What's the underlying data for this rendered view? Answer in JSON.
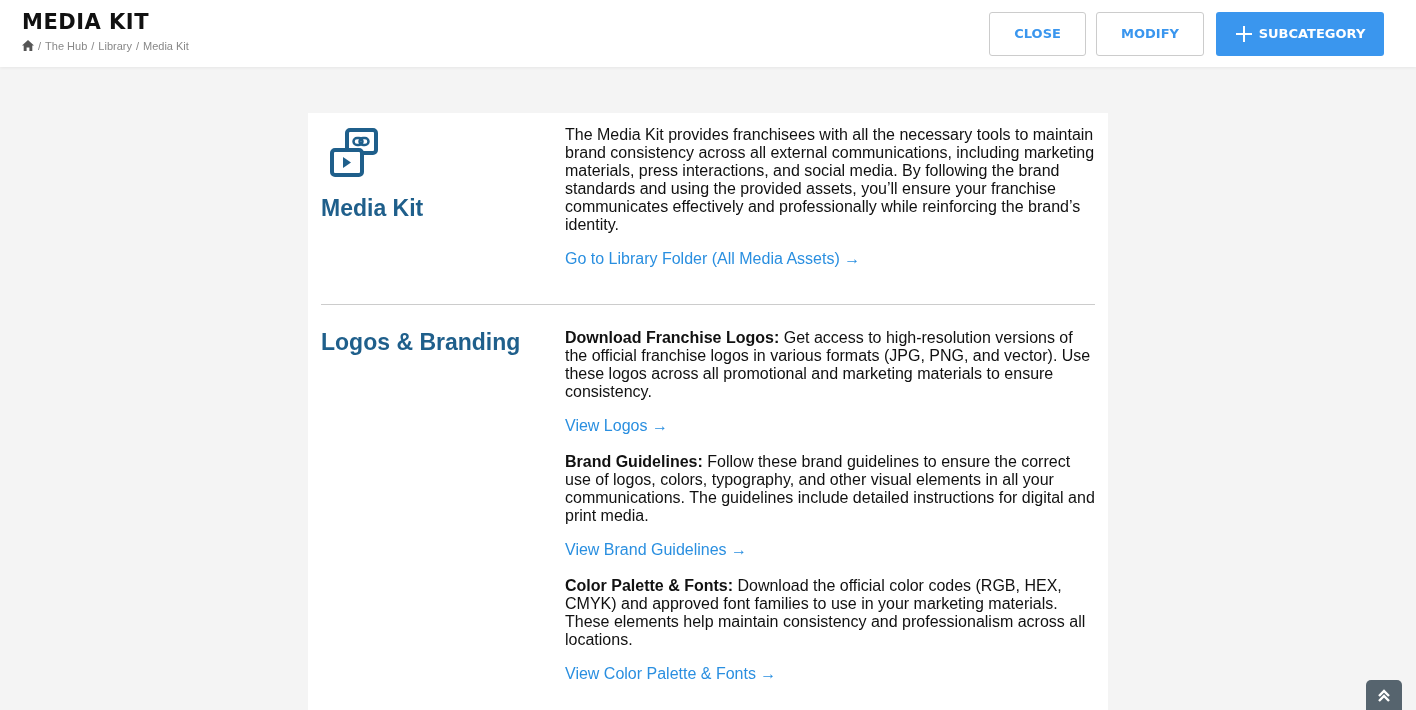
{
  "header": {
    "title": "MEDIA KIT",
    "breadcrumb_separator": "/",
    "breadcrumb": [
      "The Hub",
      "Library",
      "Media Kit"
    ],
    "buttons": [
      {
        "label": "CLOSE",
        "kind": "outline"
      },
      {
        "label": "MODIFY",
        "kind": "outline"
      },
      {
        "label": "SUBCATEGORY",
        "kind": "add"
      }
    ]
  },
  "sections": [
    {
      "title": "Media Kit",
      "kind": "intro",
      "blocks": [
        {
          "text": "The Media Kit provides franchisees with all the necessary tools to maintain brand consistency across all external communications, including marketing materials, press interactions, and social media. By following the brand standards and using the provided assets, you’ll ensure your franchise communicates effectively and professionally while reinforcing the brand’s identity.",
          "link": "Go to Library Folder (All Media Assets) →"
        }
      ]
    },
    {
      "title": "Logos & Branding",
      "kind": "plain",
      "blocks": [
        {
          "text": "**Download Franchise Logos:** Get access to high-resolution versions of the official franchise logos in various formats (JPG, PNG, and vector). Use these logos across all promotional and marketing materials to ensure consistency.",
          "link": "View Logos →"
        },
        {
          "text": "**Brand Guidelines:** Follow these brand guidelines to ensure the correct use of logos, colors, typography, and other visual elements in all your communications. The guidelines include detailed instructions for digital and print media.",
          "link": "View Brand Guidelines →"
        },
        {
          "text": "**Color Palette & Fonts:** Download the official color codes (RGB, HEX, CMYK) and approved font families to use in your marketing materials. These elements help maintain consistency and professionalism across all locations.",
          "link": "View Color Palette & Fonts →"
        }
      ]
    }
  ]
}
